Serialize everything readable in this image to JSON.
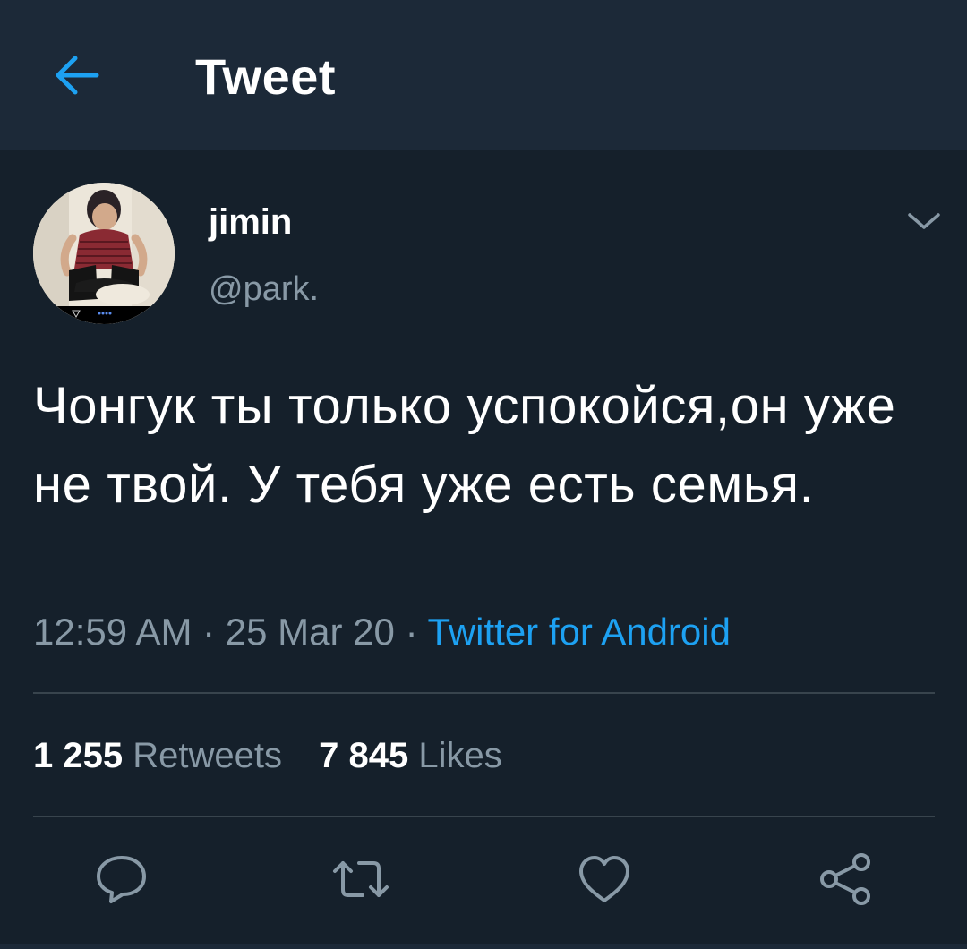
{
  "header": {
    "title": "Tweet",
    "back_icon": "arrow-left-icon",
    "accent": "#1da1f2"
  },
  "tweet": {
    "display_name": "jimin",
    "handle": "@park.",
    "text": "Чонгук ты только успокойся,он уже не твой. У тебя уже есть семья.",
    "time": "12:59 AM",
    "separator": " · ",
    "date": "25 Mar 20",
    "source": "Twitter for Android",
    "retweets_count": "1 255",
    "retweets_label": "Retweets",
    "likes_count": "7 845",
    "likes_label": "Likes"
  },
  "actions": {
    "reply_icon": "reply-icon",
    "retweet_icon": "retweet-icon",
    "like_icon": "heart-icon",
    "share_icon": "share-icon",
    "color": "#8899a6"
  },
  "colors": {
    "background": "#15202b",
    "header": "#1c2938",
    "secondary_text": "#8899a6",
    "divider": "#38444d",
    "link": "#1da1f2"
  }
}
